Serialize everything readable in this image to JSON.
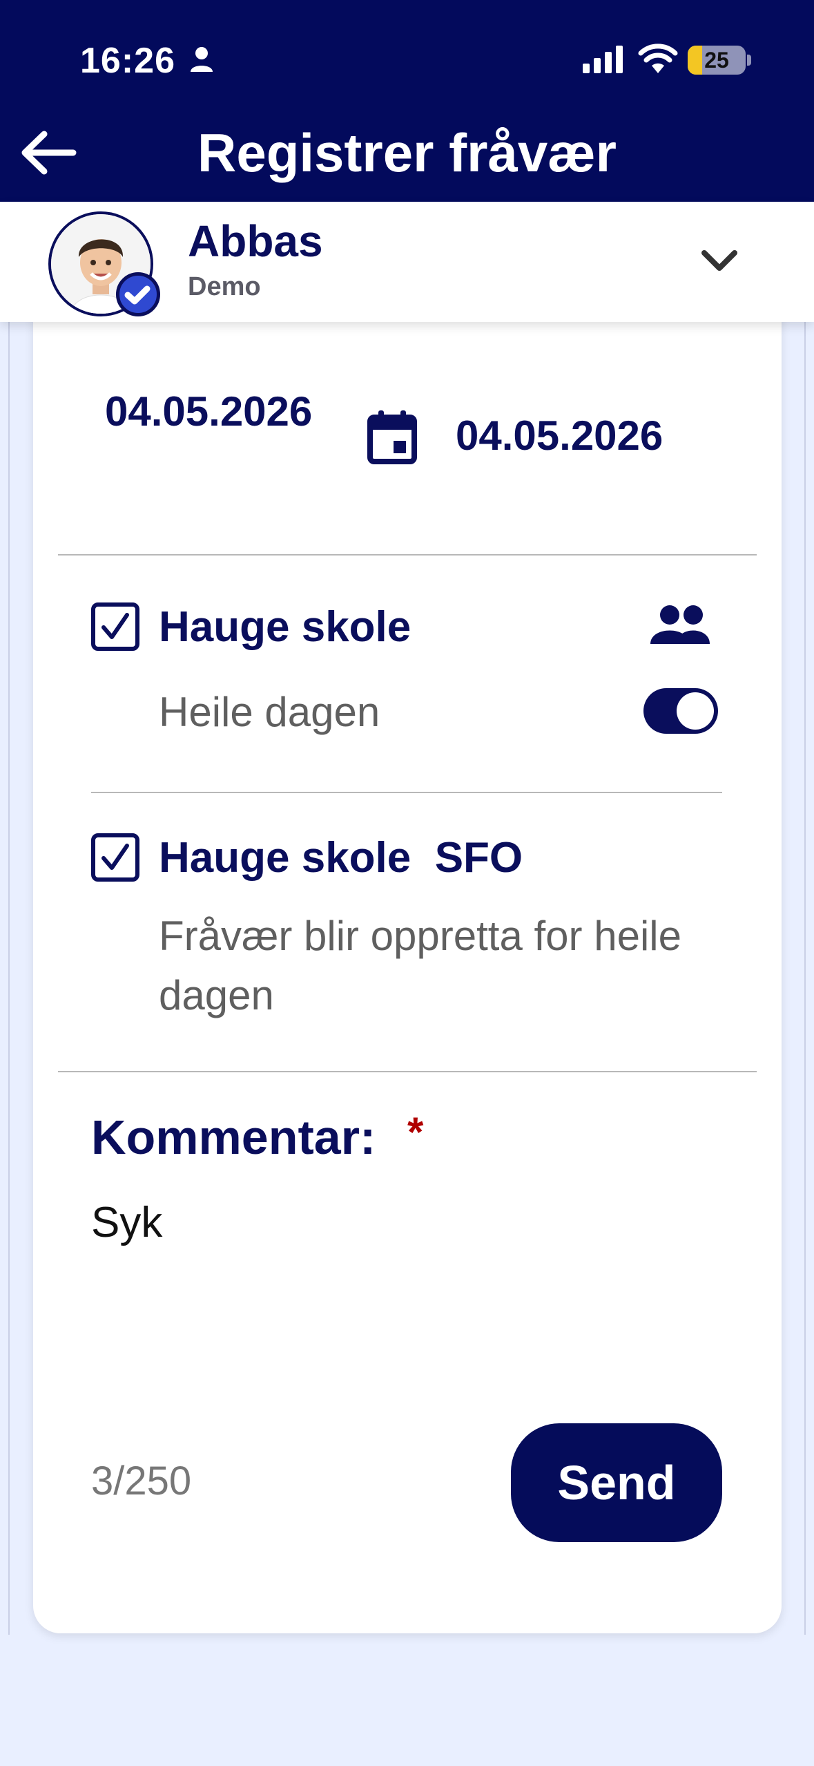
{
  "status_bar": {
    "time": "16:26",
    "battery": "25",
    "battery_level": 0.25
  },
  "header": {
    "title": "Registrer fråvær"
  },
  "profile": {
    "name": "Abbas",
    "subtitle": "Demo"
  },
  "dates": {
    "from": "04.05.2026",
    "to": "04.05.2026"
  },
  "schools": [
    {
      "name": "Hauge skole",
      "checked": true,
      "option_label": "Heile dagen",
      "toggle_on": true
    },
    {
      "name": "Hauge skole  SFO",
      "checked": true,
      "note": "Fråvær blir oppretta for heile dagen"
    }
  ],
  "comment": {
    "label": "Kommentar:",
    "required_mark": "*",
    "value": "Syk",
    "counter": "3/250"
  },
  "actions": {
    "send_label": "Send"
  },
  "colors": {
    "primary": "#030a5c",
    "background": "#e9efff",
    "required": "#b00000"
  }
}
